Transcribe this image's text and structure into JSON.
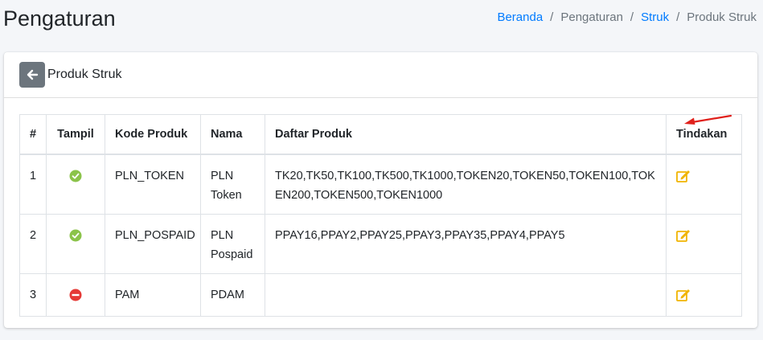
{
  "header": {
    "title": "Pengaturan",
    "breadcrumb": [
      {
        "label": "Beranda",
        "link": true
      },
      {
        "label": "Pengaturan",
        "link": false
      },
      {
        "label": "Struk",
        "link": true
      },
      {
        "label": "Produk Struk",
        "link": false
      }
    ]
  },
  "card": {
    "title": "Produk Struk",
    "back_icon": "arrow-left-icon"
  },
  "table": {
    "columns": [
      "#",
      "Tampil",
      "Kode Produk",
      "Nama",
      "Daftar Produk",
      "Tindakan"
    ],
    "rows": [
      {
        "no": "1",
        "tampil": "check-circle-icon",
        "kode": "PLN_TOKEN",
        "nama": "PLN Token",
        "daftar": "TK20,TK50,TK100,TK500,TK1000,TOKEN20,TOKEN50,TOKEN100,TOKEN200,TOKEN500,TOKEN1000",
        "action_icon": "edit-icon"
      },
      {
        "no": "2",
        "tampil": "check-circle-icon",
        "kode": "PLN_POSPAID",
        "nama": "PLN Pospaid",
        "daftar": "PPAY16,PPAY2,PPAY25,PPAY3,PPAY35,PPAY4,PPAY5",
        "action_icon": "edit-icon"
      },
      {
        "no": "3",
        "tampil": "minus-circle-icon",
        "kode": "PAM",
        "nama": "PDAM",
        "daftar": "",
        "action_icon": "edit-icon"
      }
    ]
  },
  "colors": {
    "link": "#007bff",
    "success": "#8bc34a",
    "danger": "#e53935",
    "warning": "#f0b400",
    "annotation": "#e0201b"
  }
}
